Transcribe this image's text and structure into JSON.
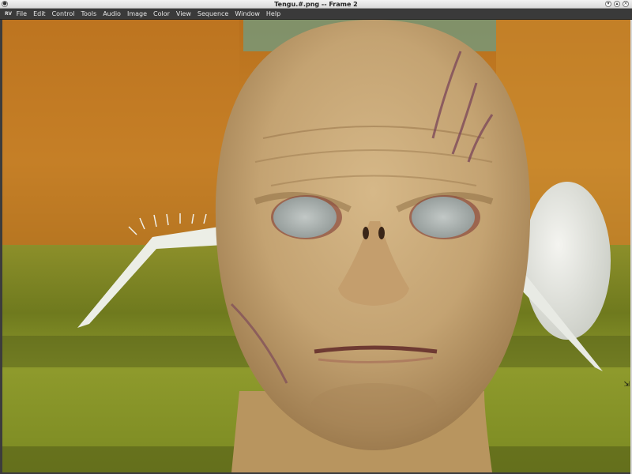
{
  "window": {
    "title": "Tengu.#.png -- Frame 2"
  },
  "menubar": {
    "logo_text": "RV",
    "items": [
      "File",
      "Edit",
      "Control",
      "Tools",
      "Audio",
      "Image",
      "Color",
      "View",
      "Sequence",
      "Window",
      "Help"
    ]
  },
  "viewport": {
    "image_description_icon": "rendered-3d-head-image"
  },
  "colors": {
    "menubar_bg": "#3a3a3a",
    "titlebar_bg": "#e6e6e6",
    "wall_orange": "#c8821f",
    "floor_green": "#7d8a22",
    "skin": "#c8a877"
  }
}
